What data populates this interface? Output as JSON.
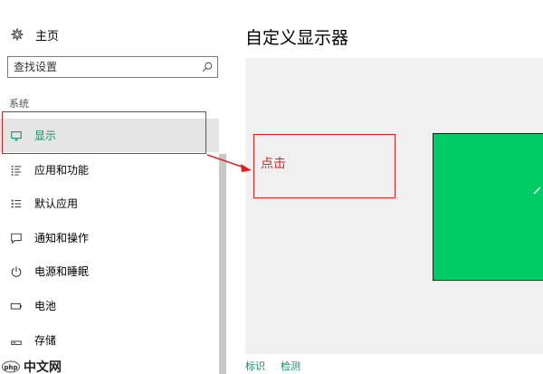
{
  "sidebar": {
    "home_label": "主页",
    "search_placeholder": "查找设置",
    "section_label": "系统",
    "items": [
      {
        "label": "显示",
        "icon": "monitor-icon",
        "active": true
      },
      {
        "label": "应用和功能",
        "icon": "apps-list-icon",
        "active": false
      },
      {
        "label": "默认应用",
        "icon": "default-apps-icon",
        "active": false
      },
      {
        "label": "通知和操作",
        "icon": "notification-icon",
        "active": false
      },
      {
        "label": "电源和睡眠",
        "icon": "power-icon",
        "active": false
      },
      {
        "label": "电池",
        "icon": "battery-icon",
        "active": false
      },
      {
        "label": "存储",
        "icon": "storage-icon",
        "active": false
      }
    ]
  },
  "main": {
    "title": "自定义显示器",
    "links": {
      "identify": "标识",
      "detect": "检测"
    }
  },
  "annotation": {
    "text": "点击",
    "color": "#e02020"
  },
  "watermark": {
    "text": "中文网"
  },
  "colors": {
    "accent": "#1a8a5f",
    "monitor": "#00cc66",
    "active_bg": "#e5e5e5",
    "preview_bg": "#f0f0f0"
  }
}
